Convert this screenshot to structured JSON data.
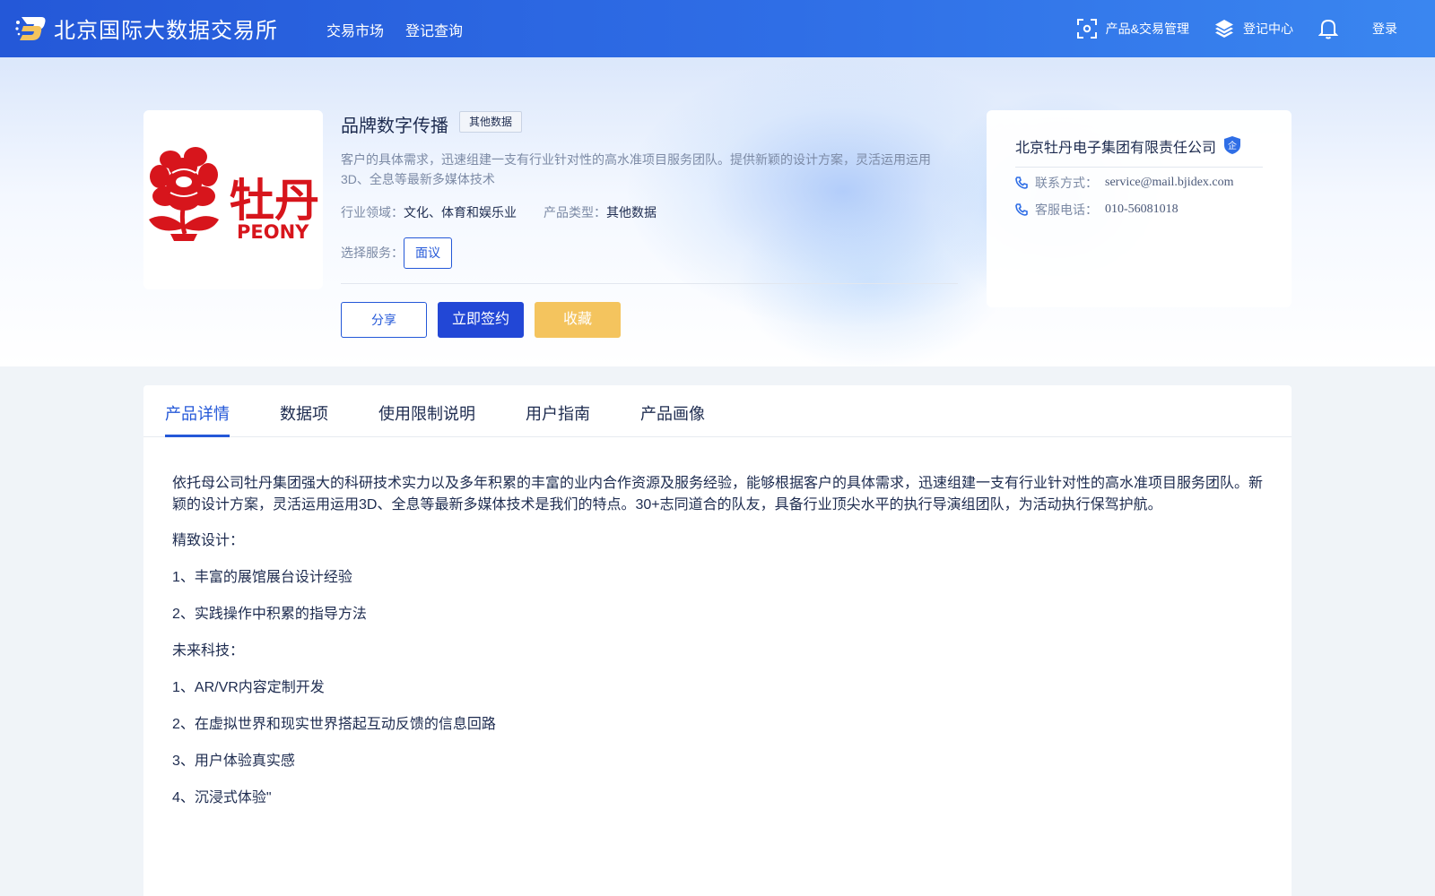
{
  "header": {
    "site_name": "北京国际大数据交易所",
    "nav": [
      "交易市场",
      "登记查询"
    ],
    "product_mgmt": "产品&交易管理",
    "register_center": "登记中心",
    "login": "登录"
  },
  "product": {
    "logo_text": "牡丹",
    "logo_sub": "PEONY",
    "title": "品牌数字传播",
    "tag": "其他数据",
    "description": "客户的具体需求，迅速组建一支有行业针对性的高水准项目服务团队。提供新颖的设计方案，灵活运用运用3D、全息等最新多媒体技术",
    "industry_label": "行业领域：",
    "industry_value": "文化、体育和娱乐业",
    "type_label": "产品类型：",
    "type_value": "其他数据",
    "service_label": "选择服务：",
    "service_option": "面议",
    "share_button": "分享",
    "sign_button": "立即签约",
    "favorite_button": "收藏"
  },
  "company": {
    "name": "北京牡丹电子集团有限责任公司",
    "badge": "企",
    "contact_label": "联系方式：",
    "contact_value": "service@mail.bjidex.com",
    "phone_label": "客服电话：",
    "phone_value": "010-56081018"
  },
  "tabs": [
    "产品详情",
    "数据项",
    "使用限制说明",
    "用户指南",
    "产品画像"
  ],
  "detail": {
    "intro": "依托母公司牡丹集团强大的科研技术实力以及多年积累的丰富的业内合作资源及服务经验，能够根据客户的具体需求，迅速组建一支有行业针对性的高水准项目服务团队。新颖的设计方案，灵活运用运用3D、全息等最新多媒体技术是我们的特点。30+志同道合的队友，具备行业顶尖水平的执行导演组团队，为活动执行保驾护航。",
    "lines": [
      "精致设计：",
      "1、丰富的展馆展台设计经验",
      "2、实践操作中积累的指导方法",
      "未来科技：",
      "1、AR/VR内容定制开发",
      "2、在虚拟世界和现实世界搭起互动反馈的信息回路",
      "3、用户体验真实感",
      "4、沉浸式体验\""
    ]
  },
  "colors": {
    "header_start": "#2458d8",
    "header_end": "#3a86f0",
    "primary": "#2247d6",
    "favorite": "#f4c45e",
    "logo_red": "#d7151c"
  }
}
